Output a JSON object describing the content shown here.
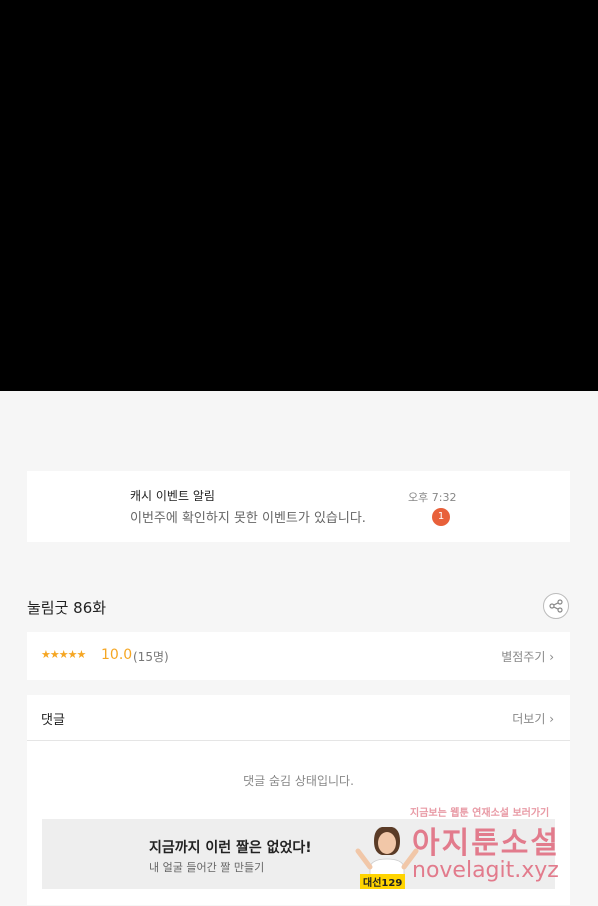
{
  "notification": {
    "title": "캐시 이벤트 알림",
    "message": "이번주에 확인하지 못한 이벤트가 있습니다.",
    "time": "오후 7:32",
    "badge": "1"
  },
  "episode": {
    "title": "눌림굿 86화"
  },
  "rating": {
    "stars": "★★★★★",
    "score": "10.0",
    "count": "(15명)",
    "rate_button": "별점주기 ›"
  },
  "comments": {
    "label": "댓글",
    "more_button": "더보기 ›",
    "hidden_message": "댓글 숨김 상태입니다."
  },
  "banner": {
    "title": "지금까지 이런 짤은 없었다!",
    "subtitle": "내 얼굴 들어간 짤 만들기",
    "image_label": "대선129"
  },
  "watermark": {
    "line1": "지금보는 웹툰 연재소설 보러가기",
    "line2": "아지툰소설",
    "line3": "novelagit.xyz"
  },
  "colors": {
    "accent": "#f5a623",
    "badge": "#e8603a",
    "watermark": "#e27b8c"
  }
}
